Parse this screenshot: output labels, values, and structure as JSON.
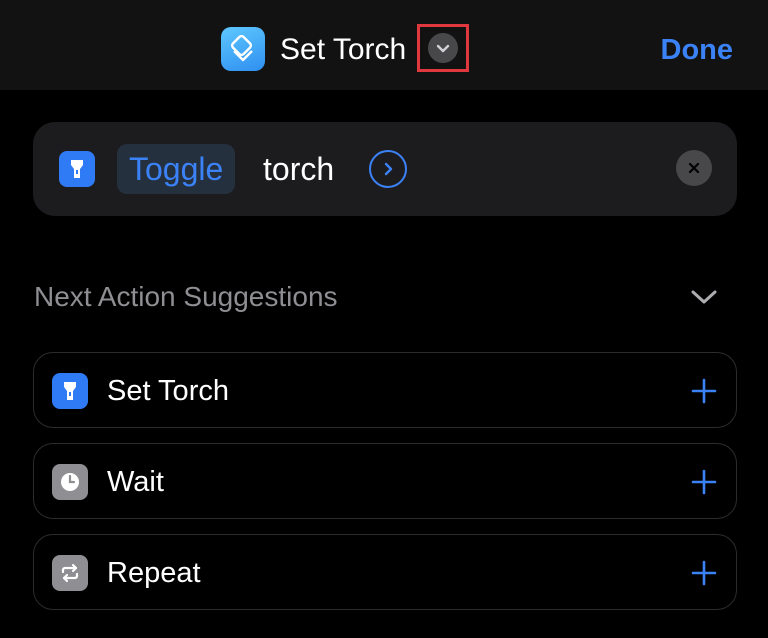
{
  "navbar": {
    "title": "Set Torch",
    "done_label": "Done",
    "app_icon": "shortcuts-icon",
    "title_chevron_icon": "chevron-down-icon"
  },
  "action": {
    "icon": "flashlight-icon",
    "token": "Toggle",
    "word": "torch",
    "expand_icon": "chevron-right-circle-icon",
    "remove_icon": "close-icon"
  },
  "suggestions_section": {
    "title": "Next Action Suggestions",
    "collapse_icon": "chevron-down-icon",
    "items": [
      {
        "label": "Set Torch",
        "icon": "flashlight-icon",
        "icon_color": "#2f7bf5"
      },
      {
        "label": "Wait",
        "icon": "clock-icon",
        "icon_color": "#8e8e93"
      },
      {
        "label": "Repeat",
        "icon": "repeat-icon",
        "icon_color": "#8e8e93"
      }
    ]
  },
  "colors": {
    "accent": "#3b82f6",
    "background": "#000000",
    "navbar": "#121212",
    "card": "#1c1c1e",
    "highlight_box": "#e0383e"
  }
}
